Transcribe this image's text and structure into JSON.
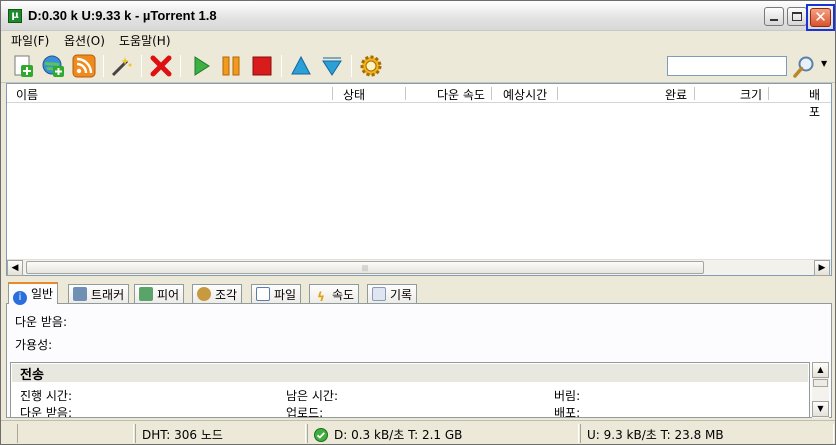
{
  "window": {
    "title": "D:0.30 k U:9.33 k - µTorrent 1.8",
    "app_icon": "µ"
  },
  "menu": [
    "파일(F)",
    "옵션(O)",
    "도움말(H)"
  ],
  "toolbar": {
    "icons": [
      "add-torrent-icon",
      "add-url-icon",
      "rss-icon",
      "create-torrent-icon",
      "remove-icon",
      "start-icon",
      "pause-icon",
      "stop-icon",
      "move-up-icon",
      "move-down-icon",
      "preferences-icon"
    ],
    "search_value": ""
  },
  "list": {
    "columns": [
      "이름",
      "상태",
      "다운 속도",
      "예상시간",
      "완료",
      "크기",
      "배포"
    ],
    "rows": []
  },
  "tabs": [
    "일반",
    "트래커",
    "피어",
    "조각",
    "파일",
    "속도",
    "기록"
  ],
  "general": {
    "downloaded_label": "다운 받음:",
    "availability_label": "가용성:",
    "transfer_heading": "전송",
    "elapsed_label": "진행 시간:",
    "remaining_label": "남은 시간:",
    "wasted_label": "버림:",
    "downloaded2_label": "다운 받음:",
    "uploaded_label": "업로드:",
    "seeds_label": "배포:"
  },
  "status": {
    "dht": "DHT: 306 노드",
    "download": "D: 0.3 kB/초 T: 2.1 GB",
    "upload": "U: 9.3 kB/초 T: 23.8 MB"
  },
  "colors": {
    "accent_close_outline": "#1a33d6",
    "tab_active_top": "#e68b2c"
  }
}
